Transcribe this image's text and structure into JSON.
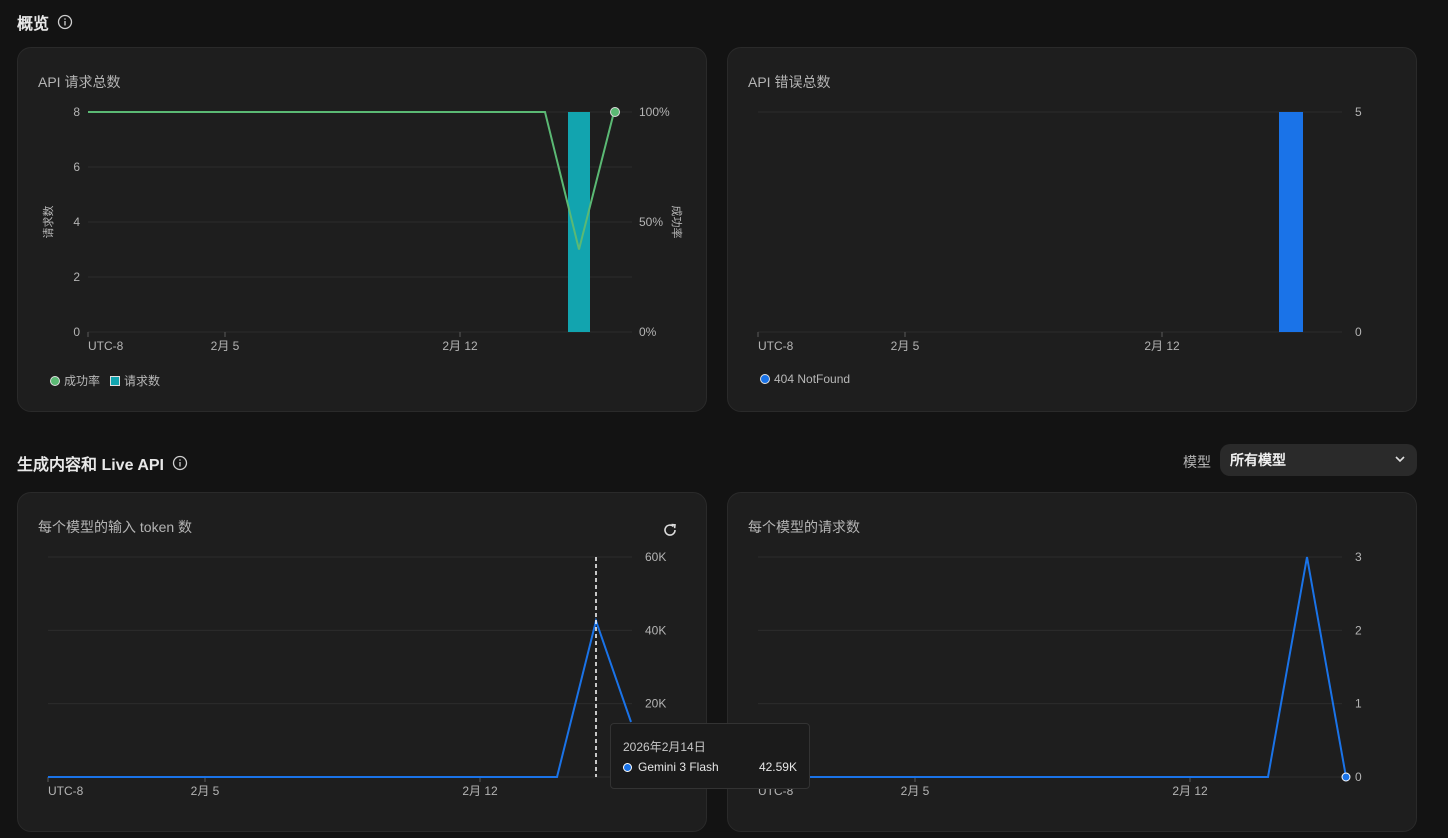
{
  "overview": {
    "title": "概览"
  },
  "cards": {
    "requests": {
      "title": "API 请求总数",
      "y_axis_label": "请求数",
      "y2_axis_label": "成功率",
      "legend": [
        {
          "label": "成功率",
          "color": "#5bb974",
          "shape": "dot"
        },
        {
          "label": "请求数",
          "color": "#12a4af",
          "shape": "square"
        }
      ]
    },
    "errors": {
      "title": "API 错误总数",
      "legend": [
        {
          "label": "404 NotFound",
          "color": "#1a73e8",
          "shape": "dot"
        }
      ]
    },
    "input_tokens": {
      "title": "每个模型的输入 token 数",
      "refresh_icon": "refresh-icon"
    },
    "model_requests": {
      "title": "每个模型的请求数"
    }
  },
  "generate": {
    "title": "生成内容和 Live API",
    "model_label": "模型",
    "model_value": "所有模型"
  },
  "tooltip": {
    "date": "2026年2月14日",
    "series": "Gemini 3 Flash",
    "value": "42.59K",
    "color": "#1a73e8"
  },
  "chart_data": [
    {
      "type": "bar",
      "title": "API 请求总数",
      "ylabel": "请求数",
      "y2label": "成功率",
      "ylim": [
        0,
        8
      ],
      "yticks": [
        "0",
        "2",
        "4",
        "6",
        "8"
      ],
      "y2lim": [
        0,
        100
      ],
      "y2ticks": [
        "0%",
        "50%",
        "100%"
      ],
      "xticks": [
        "UTC-8",
        "2月 5",
        "2月 12"
      ],
      "grid": true,
      "series": [
        {
          "name": "请求数",
          "kind": "bar",
          "color": "#12a4af",
          "points": [
            {
              "x": "2月 14",
              "y": 8
            }
          ]
        },
        {
          "name": "成功率",
          "kind": "line",
          "color": "#5bb974",
          "points": [
            {
              "x": "UTC-8",
              "y": 100
            },
            {
              "x": "2月 13",
              "y": 100
            },
            {
              "x": "2月 14",
              "y": 37.5
            },
            {
              "x": "2月 15",
              "y": 100
            }
          ]
        }
      ]
    },
    {
      "type": "bar",
      "title": "API 错误总数",
      "ylim": [
        0,
        5
      ],
      "yticks": [
        "0",
        "5"
      ],
      "xticks": [
        "UTC-8",
        "2月 5",
        "2月 12"
      ],
      "grid": true,
      "series": [
        {
          "name": "404 NotFound",
          "color": "#1a73e8",
          "points": [
            {
              "x": "2月 14",
              "y": 5
            }
          ]
        }
      ]
    },
    {
      "type": "line",
      "title": "每个模型的输入 token 数",
      "ylim": [
        0,
        60000
      ],
      "yticks": [
        "20K",
        "40K",
        "60K"
      ],
      "xticks": [
        "UTC-8",
        "2月 5",
        "2月 12"
      ],
      "grid": true,
      "series": [
        {
          "name": "Gemini 3 Flash",
          "color": "#1a73e8",
          "points": [
            {
              "x": "UTC-8",
              "y": 0
            },
            {
              "x": "2月 13",
              "y": 0
            },
            {
              "x": "2月 14",
              "y": 42590
            },
            {
              "x": "2月 15",
              "y": 15000
            }
          ]
        }
      ]
    },
    {
      "type": "line",
      "title": "每个模型的请求数",
      "ylim": [
        0,
        3
      ],
      "yticks": [
        "0",
        "1",
        "2",
        "3"
      ],
      "xticks": [
        "UTC-8",
        "2月 5",
        "2月 12"
      ],
      "grid": true,
      "series": [
        {
          "color": "#1a73e8",
          "points": [
            {
              "x": "UTC-8",
              "y": 0
            },
            {
              "x": "2月 13",
              "y": 0
            },
            {
              "x": "2月 14",
              "y": 3
            },
            {
              "x": "2月 15",
              "y": 0
            }
          ]
        }
      ]
    }
  ]
}
